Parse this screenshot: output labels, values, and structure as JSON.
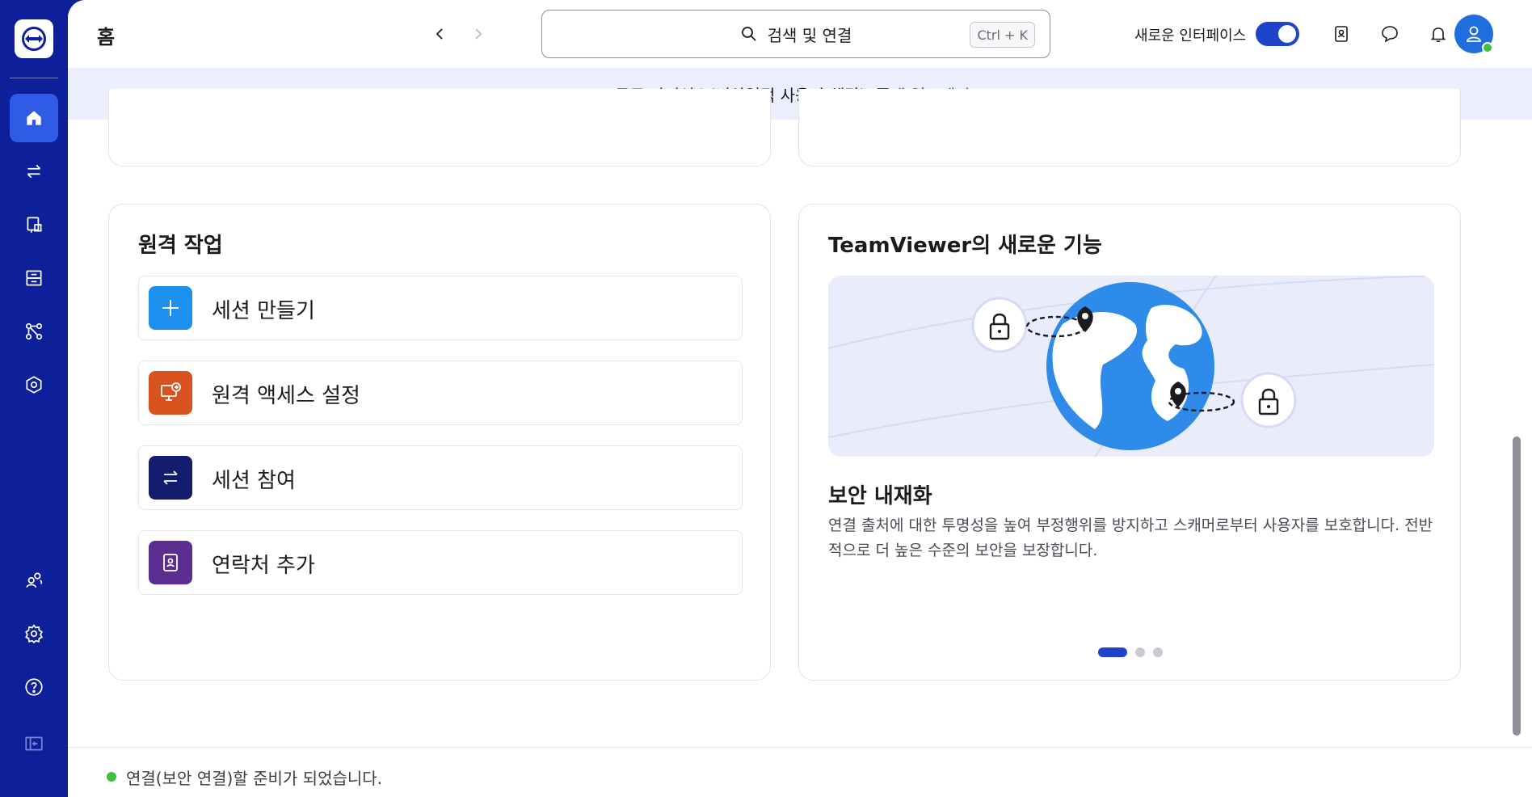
{
  "sidebar": {
    "items": [
      {
        "icon": "home-icon",
        "active": true
      },
      {
        "icon": "transfer-icon",
        "active": false
      },
      {
        "icon": "remote-device-icon",
        "active": false
      },
      {
        "icon": "sessions-icon",
        "active": false
      },
      {
        "icon": "flow-icon",
        "active": false
      },
      {
        "icon": "security-icon",
        "active": false
      },
      {
        "icon": "people-icon",
        "active": false
      },
      {
        "icon": "settings-icon",
        "active": false
      },
      {
        "icon": "help-icon",
        "active": false
      },
      {
        "icon": "collapse-icon",
        "active": false
      }
    ]
  },
  "header": {
    "title": "홈",
    "search_placeholder": "검색 및 연결",
    "search_shortcut": "Ctrl + K",
    "new_interface_label": "새로운 인터페이스",
    "new_interface_enabled": true
  },
  "banner": {
    "text": "무료 라이선스(비상업적 사용만 해당)",
    "link": "플랜 업그레이드"
  },
  "remote_work": {
    "title": "원격 작업",
    "actions": [
      {
        "label": "세션 만들기",
        "icon": "plus-icon",
        "color": "#1e90f0"
      },
      {
        "label": "원격 액세스 설정",
        "icon": "remote-access-icon",
        "color": "#d9531e"
      },
      {
        "label": "세션 참여",
        "icon": "transfer-icon",
        "color": "#141c6e"
      },
      {
        "label": "연락처 추가",
        "icon": "contact-icon",
        "color": "#5b2d8e"
      }
    ]
  },
  "whats_new": {
    "title": "TeamViewer의 새로운 기능",
    "feature_title": "보안 내재화",
    "feature_desc": "연결 출처에 대한 투명성을 높여 부정행위를 방지하고 스캐머로부터 사용자를 보호합니다. 전반적으로 더 높은 수준의 보안을 보장합니다.",
    "carousel_index": 0,
    "carousel_count": 3
  },
  "footer": {
    "status": "연결(보안 연결)할 준비가 되었습니다."
  },
  "colors": {
    "sidebar": "#0e1f9a",
    "accent": "#1f43c9",
    "banner_bg": "#ebeefd",
    "status_ok": "#3fbf3f"
  }
}
